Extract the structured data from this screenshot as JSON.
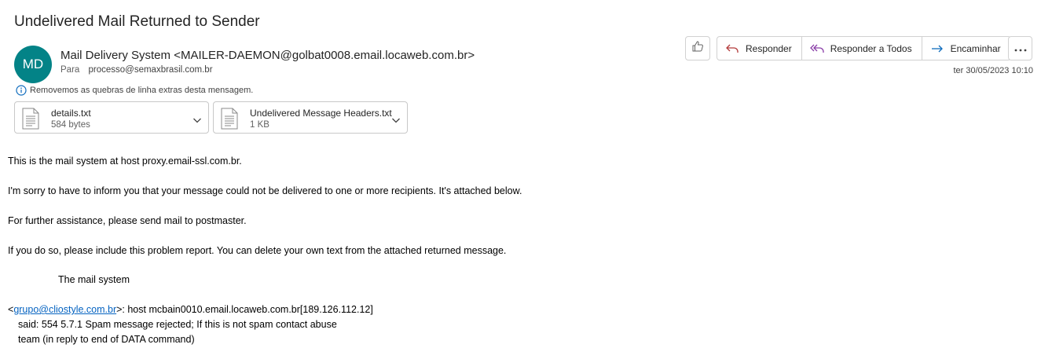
{
  "email": {
    "subject": "Undelivered Mail Returned to Sender",
    "avatar_initials": "MD",
    "avatar_color": "#038387",
    "sender": "Mail Delivery System <MAILER-DAEMON@golbat0008.email.locaweb.com.br>",
    "to_label": "Para",
    "to_address": "processo@semaxbrasil.com.br",
    "info_notice": "Removemos as quebras de linha extras desta mensagem.",
    "date": "ter 30/05/2023 10:10"
  },
  "toolbar": {
    "like_icon": "thumbs-up-icon",
    "reply_label": "Responder",
    "reply_all_label": "Responder a Todos",
    "forward_label": "Encaminhar",
    "more_icon": "more-icon",
    "reply_color": "#b33b3b",
    "reply_all_color": "#8a3ea8",
    "forward_color": "#0f6cbd"
  },
  "attachments": [
    {
      "name": "details.txt",
      "size": "584 bytes",
      "icon": "text-file-icon"
    },
    {
      "name": "Undelivered Message Headers.txt",
      "size": "1 KB",
      "icon": "text-file-icon"
    }
  ],
  "body": {
    "line1": "This is the mail system at host proxy.email-ssl.com.br.",
    "line2": "I'm sorry to have to inform you that your message could not be delivered to one or more recipients. It's attached below.",
    "line3": "For further assistance, please send mail to postmaster.",
    "line4": "If you do so, please include this problem report. You can delete your own text from the attached returned message.",
    "signature": "The mail system",
    "bounce_open": "<",
    "bounce_link": "grupo@cliostyle.com.br",
    "bounce_rest": ">: host mcbain0010.email.locaweb.com.br[189.126.112.12]",
    "said_line1": "said: 554 5.7.1 Spam message rejected; If this is not spam contact abuse",
    "said_line2": "team (in reply to end of DATA command)"
  }
}
